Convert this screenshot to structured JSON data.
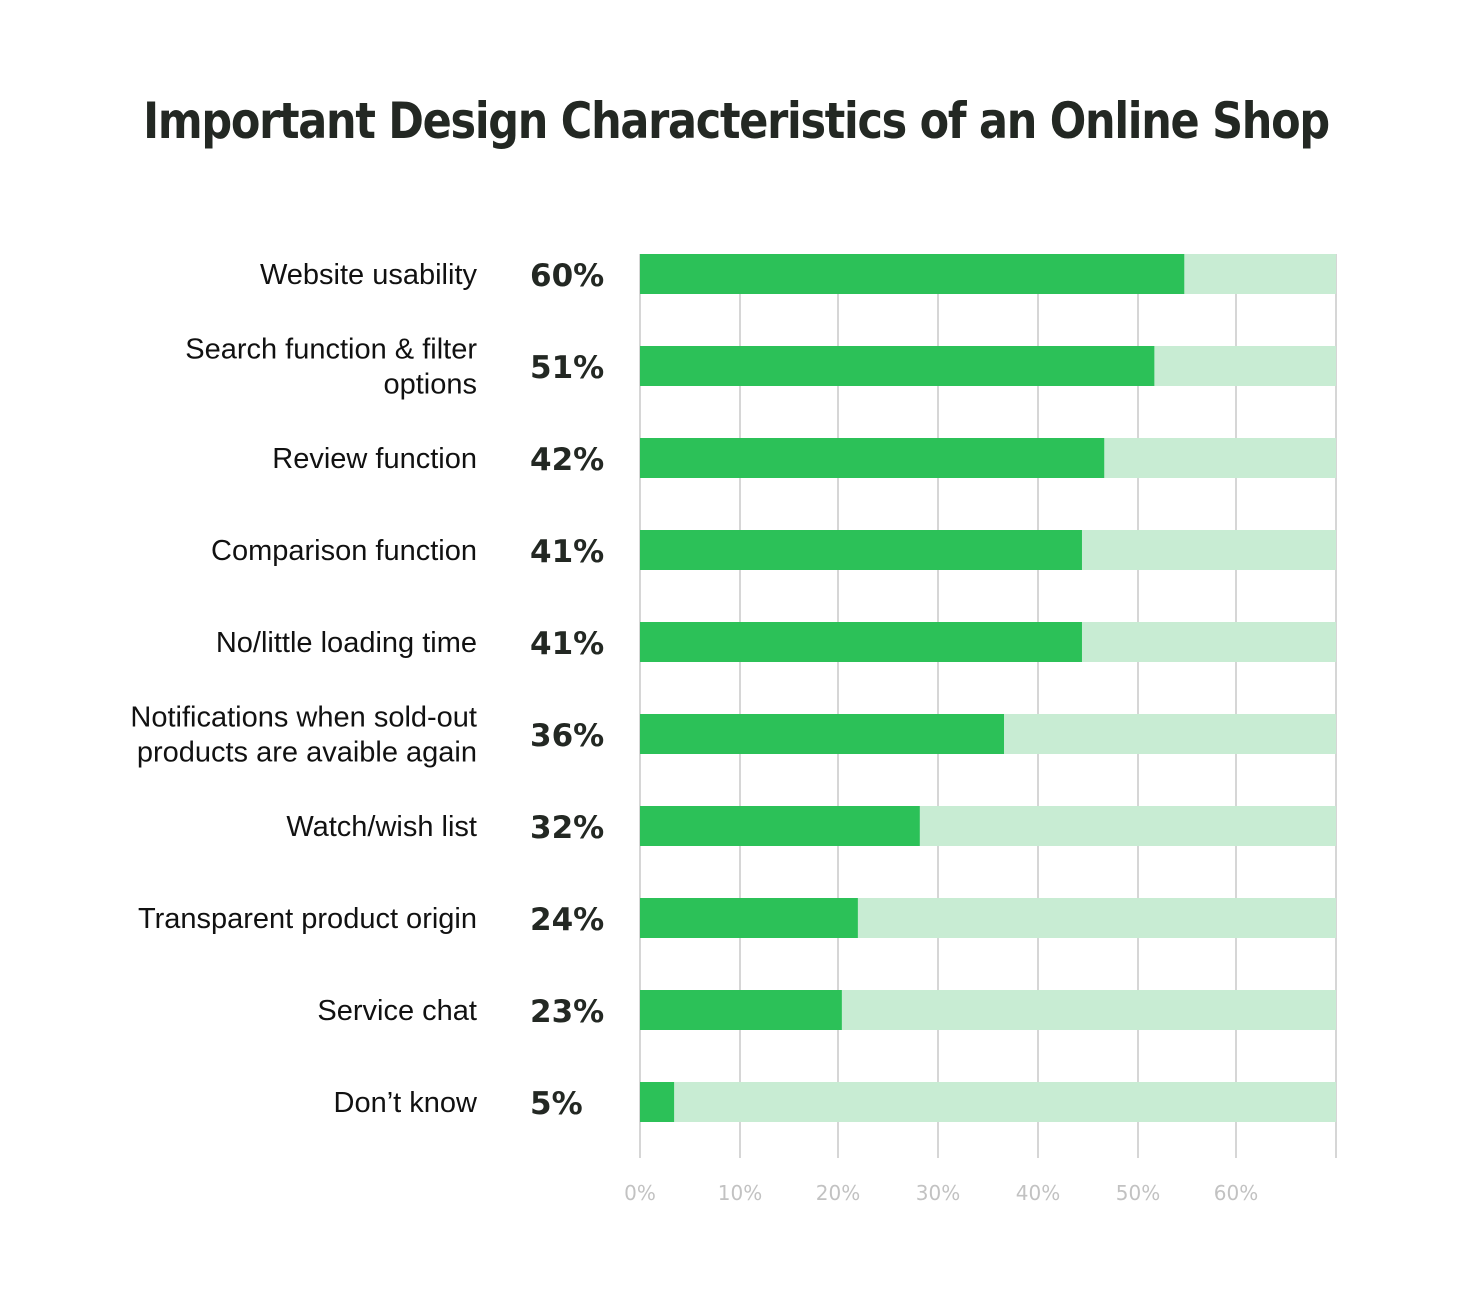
{
  "chart_data": {
    "type": "bar",
    "orientation": "horizontal",
    "title": "Important Design Characteristics of an Online Shop",
    "xlabel": "",
    "ylabel": "",
    "categories": [
      [
        "Website usability"
      ],
      [
        "Search function & filter",
        "options"
      ],
      [
        "Review function"
      ],
      [
        "Comparison function"
      ],
      [
        "No/little loading time"
      ],
      [
        "Notifications when sold-out",
        "products are avaible again"
      ],
      [
        "Watch/wish list"
      ],
      [
        "Transparent product origin"
      ],
      [
        "Service chat"
      ],
      [
        "Don’t know"
      ]
    ],
    "values": [
      60,
      51,
      42,
      41,
      41,
      36,
      32,
      24,
      23,
      5
    ],
    "value_labels": [
      "60%",
      "51%",
      "42%",
      "41%",
      "41%",
      "36%",
      "32%",
      "24%",
      "23%",
      "5%"
    ],
    "bar_fill_fraction": [
      0.782,
      0.739,
      0.667,
      0.635,
      0.635,
      0.523,
      0.402,
      0.313,
      0.29,
      0.049
    ],
    "x_ticks": [
      "0%",
      "10%",
      "20%",
      "30%",
      "40%",
      "50%",
      "60%"
    ],
    "xlim": [
      0,
      70
    ],
    "grid": true,
    "legend": "none",
    "colors": {
      "bar": "#2cc158",
      "track": "#c8ecd3",
      "grid": "#d6d6d6",
      "title": "#232823",
      "tick_label": "#c2c2c2"
    }
  }
}
